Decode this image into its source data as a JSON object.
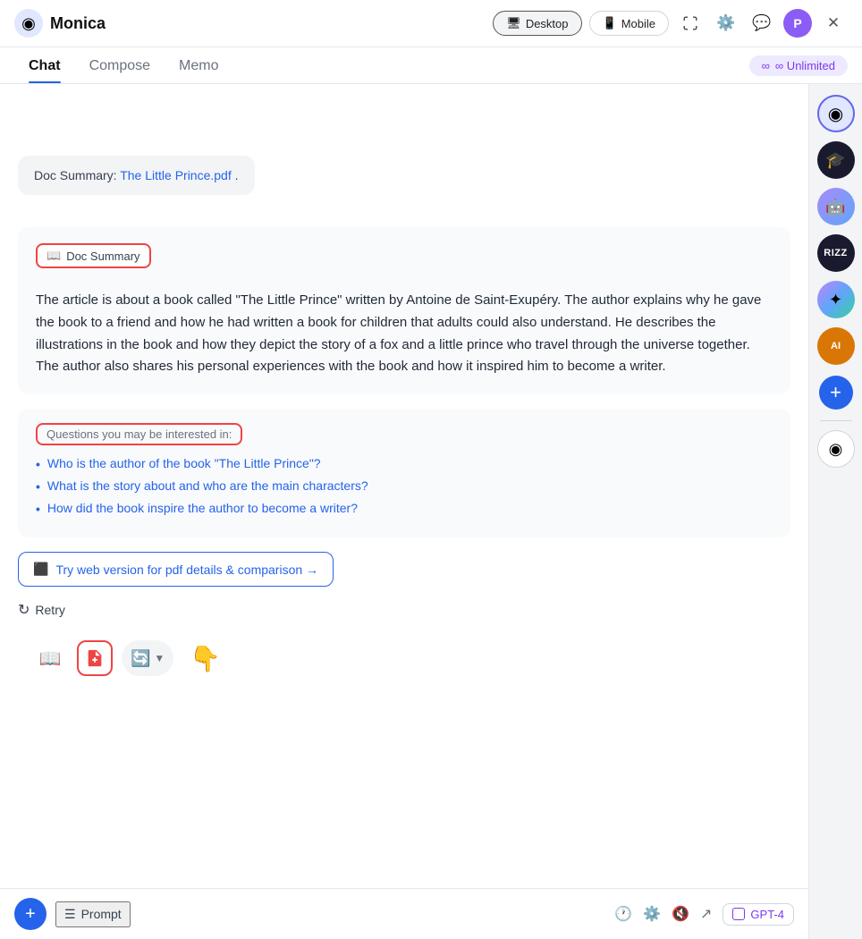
{
  "header": {
    "logo_label": "Monica",
    "title": "Monica",
    "desktop_btn": "Desktop",
    "mobile_btn": "Mobile",
    "avatar_letter": "P"
  },
  "tabs": {
    "items": [
      "Chat",
      "Compose",
      "Memo"
    ],
    "active": "Chat",
    "unlimited_label": "∞ Unlimited"
  },
  "chat": {
    "doc_ref": {
      "prefix": "Doc Summary: ",
      "link_text": "The Little Prince.pdf",
      "suffix": "."
    },
    "doc_summary_tag": "Doc Summary",
    "ai_response_text": "The article is about a book called \"The Little Prince\" written by Antoine de Saint-Exupéry. The author explains why he gave the book to a friend and how he had written a book for children that adults could also understand. He describes the illustrations in the book and how they depict the story of a fox and a little prince who travel through the universe together. The author also shares his personal experiences with the book and how it inspired him to become a writer.",
    "questions_label": "Questions you may be interested in:",
    "questions": [
      "Who is the author of the book \"The Little Prince\"?",
      "What is the story about and who are the main characters?",
      "How did the book inspire the author to become a writer?"
    ],
    "web_version_btn": "Try web version for pdf details & comparison →",
    "retry_label": "Retry"
  },
  "toolbar": {
    "book_icon": "📖",
    "pdf_icon": "📄",
    "model_icon": "🔄"
  },
  "input_bar": {
    "prompt_label": "Prompt",
    "gpt4_label": "GPT-4"
  },
  "right_sidebar": {
    "items": [
      {
        "id": "monica-top",
        "emoji": "◉",
        "bg": "#e0e7ff"
      },
      {
        "id": "gpt4",
        "emoji": "🎓",
        "bg": "#1a1a2e"
      },
      {
        "id": "colorful",
        "emoji": "🤖",
        "bg": "#c084fc"
      },
      {
        "id": "rizz",
        "label": "RIZZ",
        "bg": "#1a1a2e"
      },
      {
        "id": "gemini",
        "emoji": "✦",
        "bg": "linear-gradient(135deg,#c084fc,#60a5fa,#34d399)"
      },
      {
        "id": "anthropic",
        "label": "AI",
        "bg": "#d97706"
      },
      {
        "id": "add",
        "symbol": "+"
      },
      {
        "id": "monica-bottom",
        "emoji": "◉",
        "bg": "#fff"
      }
    ]
  }
}
